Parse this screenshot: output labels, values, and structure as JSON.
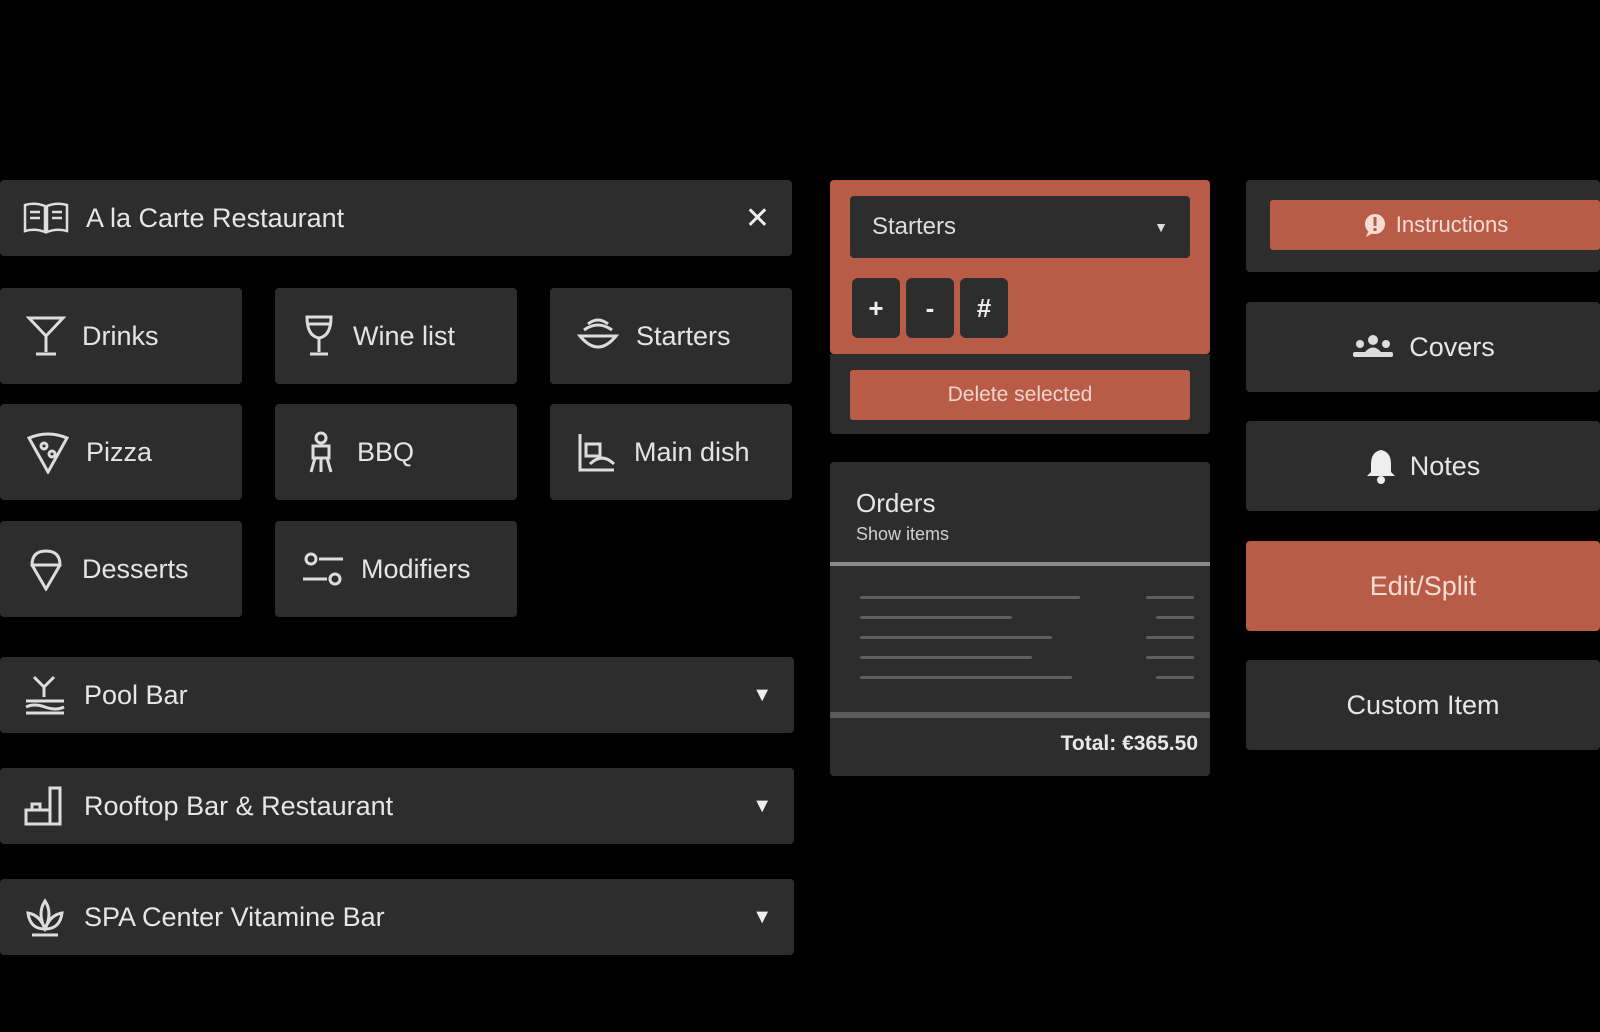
{
  "outlet": {
    "title": "A la Carte Restaurant",
    "icon": "menu-book-icon",
    "close_icon": "close-icon"
  },
  "categories": [
    {
      "label": "Drinks",
      "icon": "cocktail-icon"
    },
    {
      "label": "Wine list",
      "icon": "wine-glass-icon"
    },
    {
      "label": "Starters",
      "icon": "starter-bowl-icon"
    },
    {
      "label": "Pizza",
      "icon": "pizza-icon"
    },
    {
      "label": "BBQ",
      "icon": "bbq-icon"
    },
    {
      "label": "Main dish",
      "icon": "main-dish-icon"
    },
    {
      "label": "Desserts",
      "icon": "ice-cream-icon"
    },
    {
      "label": "Modifiers",
      "icon": "sliders-icon"
    }
  ],
  "other_outlets": [
    {
      "label": "Pool Bar",
      "icon": "pool-icon"
    },
    {
      "label": "Rooftop Bar & Restaurant",
      "icon": "rooftop-icon"
    },
    {
      "label": "SPA Center Vitamine Bar",
      "icon": "lotus-icon"
    }
  ],
  "course": {
    "selected": "Starters",
    "qty_buttons": [
      "+",
      "-",
      "#"
    ],
    "delete_label": "Delete selected"
  },
  "orders": {
    "title": "Orders",
    "subtitle": "Show items",
    "total": "Total: €365.50"
  },
  "actions": {
    "instructions": "Instructions",
    "covers": "Covers",
    "notes": "Notes",
    "edit_split": "Edit/Split",
    "custom_item": "Custom Item"
  },
  "colors": {
    "accent": "#b85c48",
    "panel": "#2d2d2d",
    "background": "#000000"
  }
}
